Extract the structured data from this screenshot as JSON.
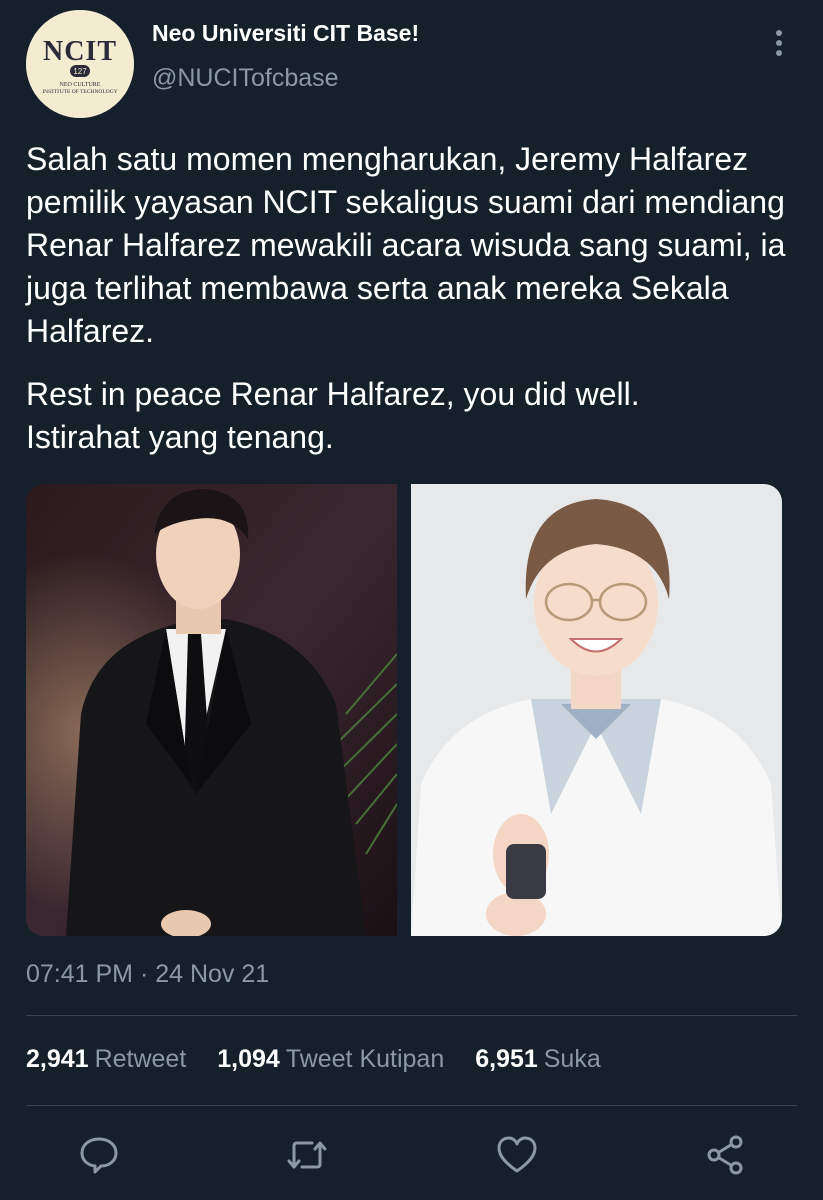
{
  "account": {
    "display_name": "Neo Universiti CIT Base!",
    "handle": "@NUCITofcbase",
    "avatar": {
      "logo_text": "NCIT",
      "badge": "127",
      "subtitle_line1": "NEO CULTURE",
      "subtitle_line2": "INSTITUTE OF TECHNOLOGY"
    }
  },
  "tweet": {
    "paragraph1": "Salah satu momen mengharukan, Jeremy Halfarez pemilik yayasan NCIT sekaligus suami dari mendiang Renar Halfarez mewakili acara wisuda sang suami, ia juga terlihat membawa serta anak mereka Sekala Halfarez.",
    "paragraph2_line1": "Rest in peace Renar Halfarez, you did well.",
    "paragraph2_line2": "Istirahat yang tenang."
  },
  "timestamp": "07:41 PM · 24 Nov 21",
  "stats": {
    "retweets": "2,941",
    "retweets_label": "Retweet",
    "quotes": "1,094",
    "quotes_label": "Tweet Kutipan",
    "likes": "6,951",
    "likes_label": "Suka"
  },
  "actions": [
    "reply-icon",
    "retweet-icon",
    "like-icon",
    "share-icon"
  ],
  "colors": {
    "background": "#15202b",
    "secondary_text": "#8b98a5",
    "divider": "#38444d"
  }
}
